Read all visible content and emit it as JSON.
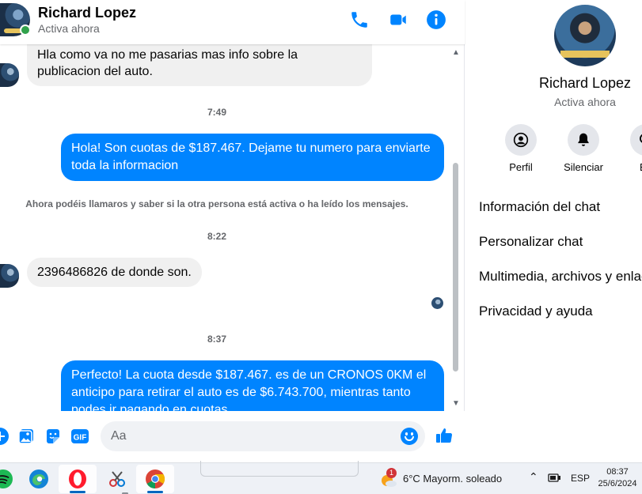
{
  "header": {
    "name": "Richard Lopez",
    "status": "Activa ahora"
  },
  "messages": {
    "incoming_1": "Hla como va no me pasarias mas info sobre la publicacion del auto.",
    "time_1": "7:49",
    "outgoing_1": "Hola! Son cuotas de $187.467. Dejame tu numero para enviarte toda la informacion",
    "notice": "Ahora podéis llamaros y saber si la otra persona está activa o ha leído los mensajes.",
    "time_2": "8:22",
    "incoming_2": "2396486826 de donde son.",
    "time_3": "8:37",
    "outgoing_2": "Perfecto! La cuota desde $187.467. es de un CRONOS 0KM el anticipo para retirar el auto es de $6.743.700, mientras tanto podes ir pagando en cuotas"
  },
  "composer": {
    "placeholder": "Aa",
    "gif_label": "GIF"
  },
  "panel": {
    "name": "Richard Lopez",
    "status": "Activa ahora",
    "actions": [
      "Perfil",
      "Silenciar",
      "Bu"
    ],
    "sections": [
      "Información del chat",
      "Personalizar chat",
      "Multimedia, archivos y enlaces",
      "Privacidad y ayuda"
    ]
  },
  "taskbar": {
    "weather_badge": "1",
    "weather": "6°C  Mayorm. soleado",
    "language": "ESP",
    "time": "08:37",
    "date": "25/6/2024"
  },
  "colors": {
    "messenger_blue": "#0084ff",
    "online_green": "#31a24c"
  }
}
